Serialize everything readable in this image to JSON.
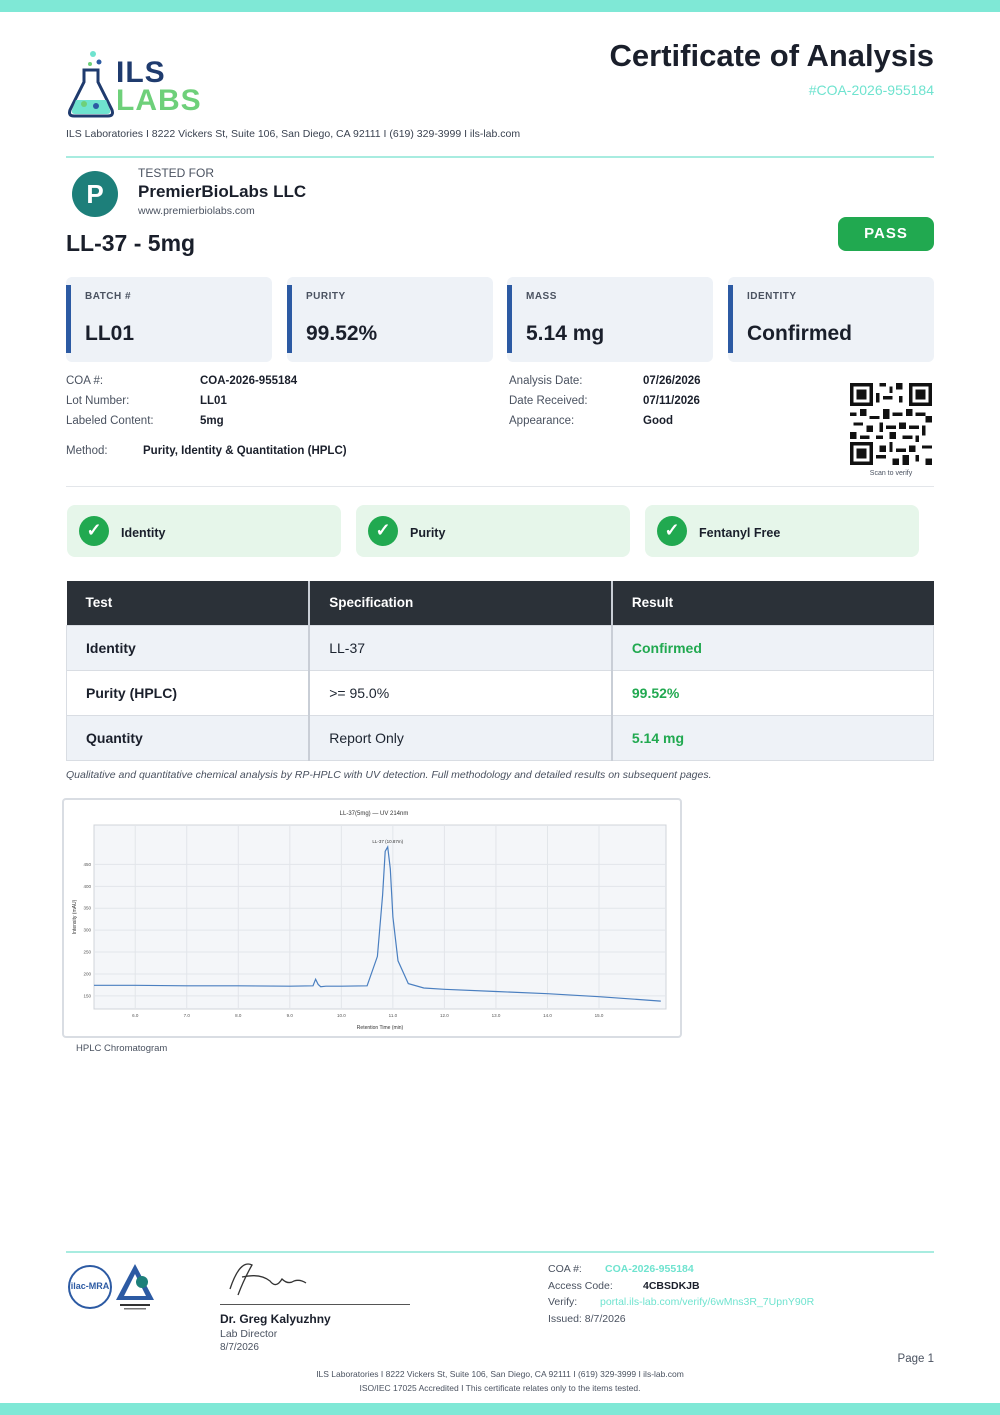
{
  "header": {
    "logo_top": "ILS",
    "logo_bottom": "LABS",
    "title": "Certificate of Analysis",
    "coa_number": "#COA-2026-955184",
    "address": "ILS Laboratories  I  8222 Vickers St, Suite 106, San Diego, CA 92111  I  (619) 329-3999  I  ils-lab.com"
  },
  "client": {
    "tested_for_label": "TESTED FOR",
    "name": "PremierBioLabs LLC",
    "url": "www.premierbiolabs.com",
    "logo_letter": "P"
  },
  "product": {
    "name": "LL-37 - 5mg",
    "status": "PASS"
  },
  "stats": [
    {
      "label": "BATCH #",
      "value": "LL01"
    },
    {
      "label": "PURITY",
      "value": "99.52%"
    },
    {
      "label": "MASS",
      "value": "5.14 mg"
    },
    {
      "label": "IDENTITY",
      "value": "Confirmed"
    }
  ],
  "details": {
    "left": [
      {
        "k": "COA #:",
        "v": "COA-2026-955184"
      },
      {
        "k": "Lot Number:",
        "v": "LL01"
      },
      {
        "k": "Labeled Content:",
        "v": "5mg"
      }
    ],
    "right": [
      {
        "k": "Analysis Date:",
        "v": "07/26/2026"
      },
      {
        "k": "Date Received:",
        "v": "07/11/2026"
      },
      {
        "k": "Appearance:",
        "v": "Good"
      }
    ],
    "method_label": "Method:",
    "method_value": "Purity, Identity & Quantitation (HPLC)",
    "qr_caption": "Scan to verify"
  },
  "checks": [
    {
      "label": "Identity"
    },
    {
      "label": "Purity"
    },
    {
      "label": "Fentanyl Free"
    }
  ],
  "table": {
    "headers": [
      "Test",
      "Specification",
      "Result"
    ],
    "rows": [
      [
        "Identity",
        "LL-37",
        "Confirmed"
      ],
      [
        "Purity (HPLC)",
        ">= 95.0%",
        "99.52%"
      ],
      [
        "Quantity",
        "Report Only",
        "5.14 mg"
      ]
    ],
    "note": "Qualitative and quantitative chemical analysis by RP-HPLC with UV detection. Full methodology and detailed results on subsequent pages."
  },
  "chart_data": {
    "type": "line",
    "title": "LL-37(5mg) — UV 214nm",
    "xlabel": "Retention Time (min)",
    "ylabel": "Intensity (mAU)",
    "xlim": [
      5.2,
      16.3
    ],
    "ylim": [
      120,
      540
    ],
    "xticks": [
      "6.0",
      "7.0",
      "8.0",
      "9.0",
      "10.0",
      "11.0",
      "12.0",
      "13.0",
      "14.0",
      "15.0"
    ],
    "yticks": [
      "150",
      "200",
      "250",
      "300",
      "350",
      "400",
      "450"
    ],
    "peak_label": "LL-37 (10.87m)",
    "grid": true,
    "series": [
      {
        "x": [
          5.2,
          6.0,
          7.0,
          8.0,
          9.0,
          9.45,
          9.5,
          9.55,
          9.6,
          9.7,
          10.0,
          10.5,
          10.7,
          10.8,
          10.85,
          10.9,
          10.95,
          11.0,
          11.1,
          11.3,
          11.6,
          12.0,
          13.0,
          14.0,
          15.0,
          16.2
        ],
        "y": [
          174,
          174,
          173,
          173,
          172,
          173,
          188,
          176,
          171,
          172,
          172,
          173,
          240,
          380,
          480,
          490,
          440,
          330,
          230,
          178,
          168,
          165,
          160,
          155,
          148,
          138
        ]
      }
    ]
  },
  "chart_caption": "HPLC Chromatogram",
  "footer": {
    "seal1_text": "ilac-MRA",
    "signer_name": "Dr. Greg Kalyuzhny",
    "signer_role": "Lab Director",
    "signer_date": "8/7/2026",
    "coa_label": "COA #:",
    "coa_value": "COA-2026-955184",
    "access_label": "Access Code:",
    "access_value": "4CBSDKJB",
    "verify_label": "Verify:",
    "verify_value": "portal.ils-lab.com/verify/6wMns3R_7UpnY90R",
    "issued": "Issued: 8/7/2026",
    "page": "Page 1",
    "address": "ILS Laboratories  I  8222 Vickers St, Suite 106, San Diego, CA 92111  I  (619) 329-3999  I  ils-lab.com",
    "accreditation": "ISO/IEC 17025 Accredited  I  This certificate relates only to the items tested."
  }
}
